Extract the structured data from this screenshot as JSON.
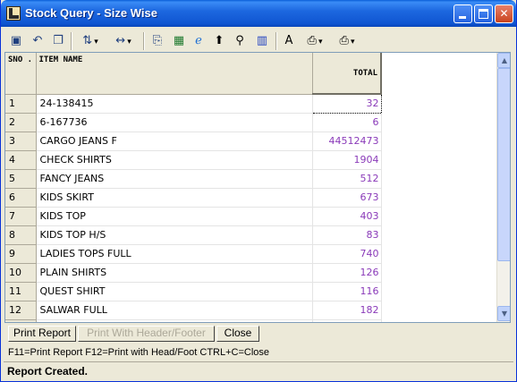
{
  "window": {
    "title": "Stock Query - Size Wise"
  },
  "toolbar": {
    "icons": [
      "save-icon",
      "undo-icon",
      "copy-window-icon",
      "sort-icon",
      "column-width-icon",
      "copy-icon",
      "excel-icon",
      "browser-icon",
      "up-arrow-icon",
      "find-icon",
      "chart-icon",
      "font-icon",
      "print-preview-icon",
      "print-icon"
    ]
  },
  "grid": {
    "headers": {
      "sno": "SNO .",
      "item_name": "ITEM NAME",
      "total": "TOTAL"
    },
    "rows": [
      {
        "sno": "1",
        "item_name": "24-138415",
        "total": "32"
      },
      {
        "sno": "2",
        "item_name": "6-167736",
        "total": "6"
      },
      {
        "sno": "3",
        "item_name": "CARGO JEANS F",
        "total": "44512473"
      },
      {
        "sno": "4",
        "item_name": "CHECK SHIRTS",
        "total": "1904"
      },
      {
        "sno": "5",
        "item_name": "FANCY JEANS",
        "total": "512"
      },
      {
        "sno": "6",
        "item_name": "KIDS SKIRT",
        "total": "673"
      },
      {
        "sno": "7",
        "item_name": "KIDS TOP",
        "total": "403"
      },
      {
        "sno": "8",
        "item_name": "KIDS TOP H/S",
        "total": "83"
      },
      {
        "sno": "9",
        "item_name": "LADIES TOPS FULL",
        "total": "740"
      },
      {
        "sno": "10",
        "item_name": "PLAIN SHIRTS",
        "total": "126"
      },
      {
        "sno": "11",
        "item_name": "QUEST SHIRT",
        "total": "116"
      },
      {
        "sno": "12",
        "item_name": "SALWAR FULL",
        "total": "182"
      }
    ]
  },
  "buttons": {
    "print_report": "Print Report",
    "print_with_header": "Print With Header/Footer",
    "close": "Close"
  },
  "shortcuts": "F11=Print Report  F12=Print with Head/Foot  CTRL+C=Close",
  "status": "Report Created.",
  "colors": {
    "title_bar": "#0a5fd8",
    "total_text": "#8a3ab9",
    "window_bg": "#ece9d8"
  }
}
